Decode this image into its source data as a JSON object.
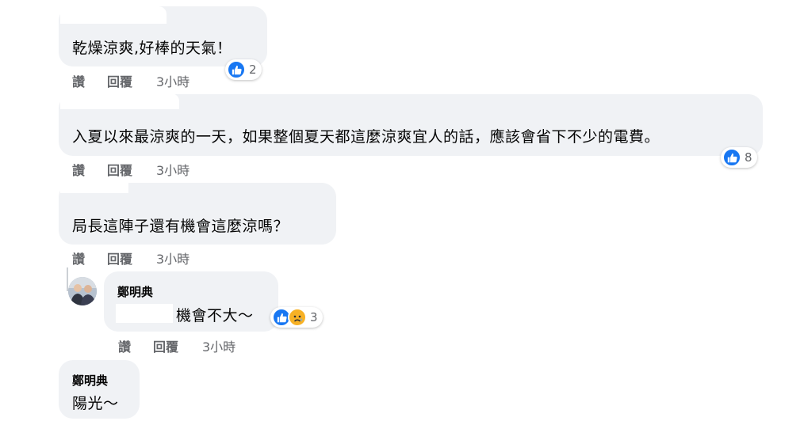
{
  "labels": {
    "like": "讚",
    "reply": "回覆"
  },
  "comments": [
    {
      "author": "",
      "text": "乾燥涼爽,好棒的天氣！",
      "time": "3小時",
      "reactions": {
        "icons": [
          "like-icon"
        ],
        "count": "2"
      }
    },
    {
      "author": "",
      "text": "入夏以來最涼爽的一天，如果整個夏天都這麼涼爽宜人的話，應該會省下不少的電費。",
      "time": "3小時",
      "reactions": {
        "icons": [
          "like-icon"
        ],
        "count": "8"
      }
    },
    {
      "author": "",
      "text": "局長這陣子還有機會這麼涼嗎？",
      "time": "3小時",
      "reactions": null
    }
  ],
  "reply": {
    "author": "鄭明典",
    "text": "機會不大～",
    "time": "3小時",
    "reactions": {
      "icons": [
        "like-icon",
        "sad-icon"
      ],
      "count": "3"
    }
  },
  "comment4": {
    "author": "鄭明典",
    "text": "陽光～"
  },
  "colors": {
    "bubble": "#f0f2f5",
    "text": "#050505",
    "meta": "#65676b",
    "like": "#1877f2",
    "sad": "#f7b125"
  }
}
